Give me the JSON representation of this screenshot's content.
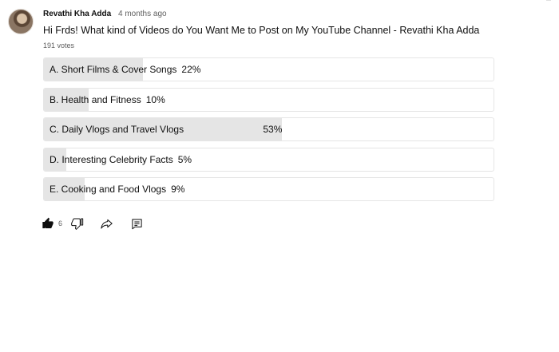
{
  "post": {
    "author": "Revathi Kha Adda",
    "time": "4 months ago",
    "question": "Hi Frds! What kind of Videos do You Want Me to Post on My YouTube Channel - Revathi Kha Adda",
    "votes": "191 votes"
  },
  "poll": {
    "options": [
      {
        "label": "A. Short Films & Cover Songs",
        "percent_text": "22%",
        "percent": 22
      },
      {
        "label": "B. Health and Fitness",
        "percent_text": "10%",
        "percent": 10
      },
      {
        "label": "C. Daily Vlogs and Travel Vlogs",
        "percent_text": "53%",
        "percent": 53
      },
      {
        "label": "D. Interesting Celebrity Facts",
        "percent_text": "5%",
        "percent": 5
      },
      {
        "label": "E. Cooking and Food Vlogs",
        "percent_text": "9%",
        "percent": 9
      }
    ]
  },
  "actions": {
    "like_count": "6",
    "icons": {
      "like": "thumbs-up-icon",
      "dislike": "thumbs-down-icon",
      "share": "share-icon",
      "comment": "comment-icon"
    }
  },
  "colors": {
    "fill": "#e5e5e5",
    "border": "#e5e5e5",
    "text": "#0f0f0f",
    "secondary_text": "#606060"
  }
}
